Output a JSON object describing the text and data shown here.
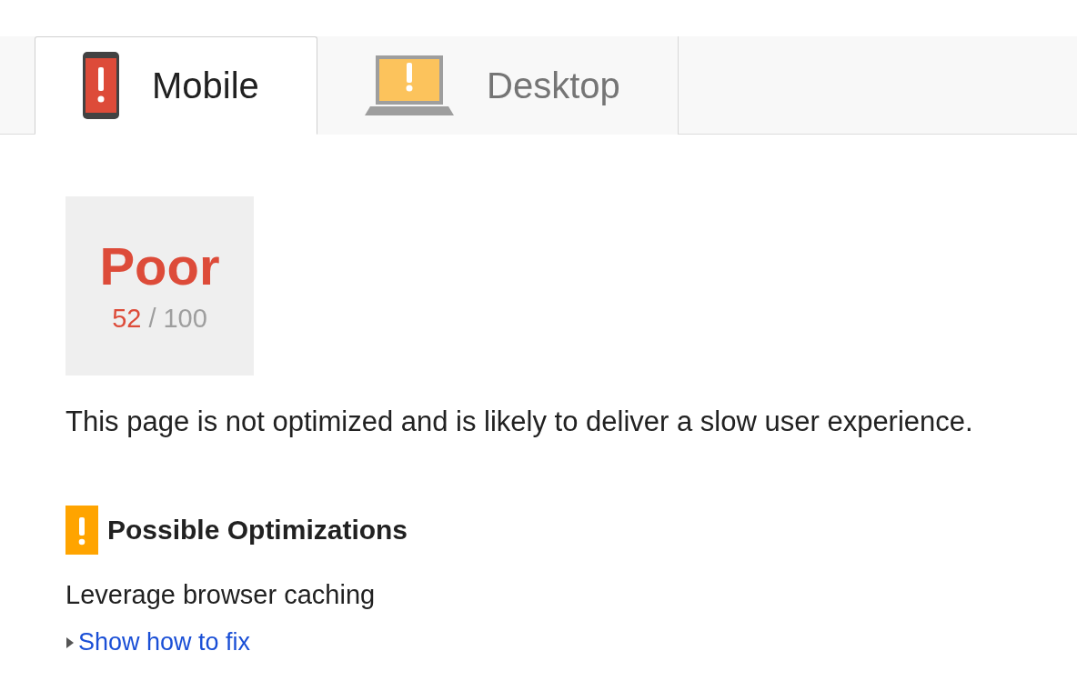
{
  "tabs": [
    {
      "label": "Mobile",
      "kind": "phone",
      "selected": true
    },
    {
      "label": "Desktop",
      "kind": "laptop",
      "selected": false
    }
  ],
  "score": {
    "kind": "poor",
    "verdict": "Poor",
    "value": "52",
    "separator": "/",
    "max": "100"
  },
  "summary": "This page is not optimized and is likely to deliver a slow user experience.",
  "section": {
    "kind": "warning",
    "title": "Possible Optimizations",
    "items": [
      {
        "title": "Leverage browser caching",
        "link": "Show how to fix",
        "expanded": false
      }
    ]
  }
}
